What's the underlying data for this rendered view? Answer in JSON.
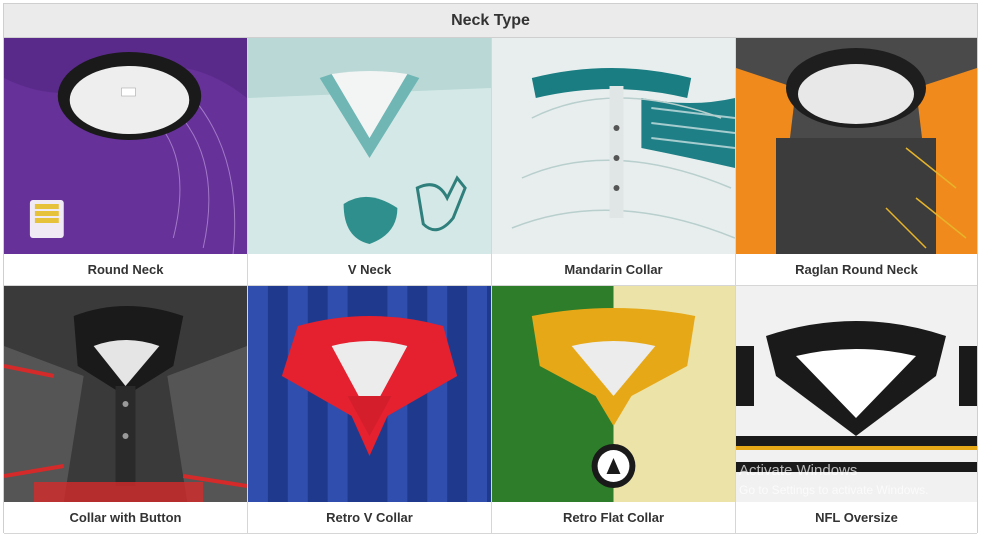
{
  "table": {
    "header": "Neck Type",
    "items": [
      {
        "label": "Round Neck"
      },
      {
        "label": "V Neck"
      },
      {
        "label": "Mandarin Collar"
      },
      {
        "label": "Raglan Round Neck"
      },
      {
        "label": "Collar with Button"
      },
      {
        "label": "Retro V Collar"
      },
      {
        "label": "Retro Flat Collar"
      },
      {
        "label": "NFL Oversize"
      }
    ]
  },
  "watermark": {
    "line1": "Activate Windows",
    "line2": "Go to Settings to activate Windows."
  },
  "colors": {
    "header_bg": "#ebebeb",
    "grid_border": "#d6d6d6"
  }
}
